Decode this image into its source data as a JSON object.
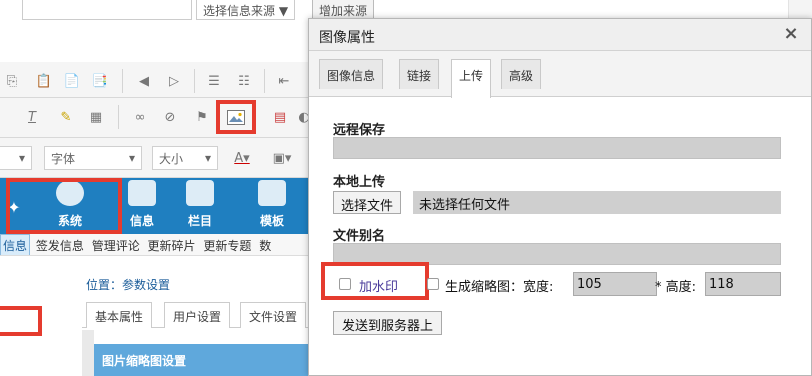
{
  "background": {
    "source_select": "选择信息来源 ▼",
    "add_source_button": "增加来源",
    "font_combo": "字体",
    "size_combo": "大小",
    "nav": [
      "",
      "系统",
      "信息",
      "栏目",
      "模板"
    ],
    "subnav": [
      "信息",
      "签发信息",
      "管理评论",
      "更新碎片",
      "更新专题",
      "数"
    ],
    "position_label": "位置：",
    "position_link": "参数设置",
    "tabs": [
      "基本属性",
      "用户设置",
      "文件设置"
    ],
    "banner": "图片缩略图设置"
  },
  "dialog": {
    "title": "图像属性",
    "close": "×",
    "tabs": [
      "图像信息",
      "链接",
      "上传",
      "高级"
    ],
    "active_tab": "上传",
    "remote_save_label": "远程保存",
    "local_upload_label": "本地上传",
    "choose_file_button": "选择文件",
    "no_file_text": "未选择任何文件",
    "file_alias_label": "文件别名",
    "watermark_label": "加水印",
    "thumbnail_label": "生成缩略图：",
    "width_label": "宽度:",
    "width_value": "105",
    "height_label": "* 高度:",
    "height_value": "118",
    "send_button": "发送到服务器上"
  },
  "colors": {
    "highlight_red": "#e53b2e",
    "nav_blue": "#1f7fc0",
    "watermark_text": "#4a3b9b"
  },
  "icons": [
    "undo-icon",
    "redo-icon",
    "paste-icon",
    "clear-format-icon",
    "link-icon",
    "unlink-icon",
    "anchor-icon",
    "image-icon",
    "close-icon"
  ]
}
